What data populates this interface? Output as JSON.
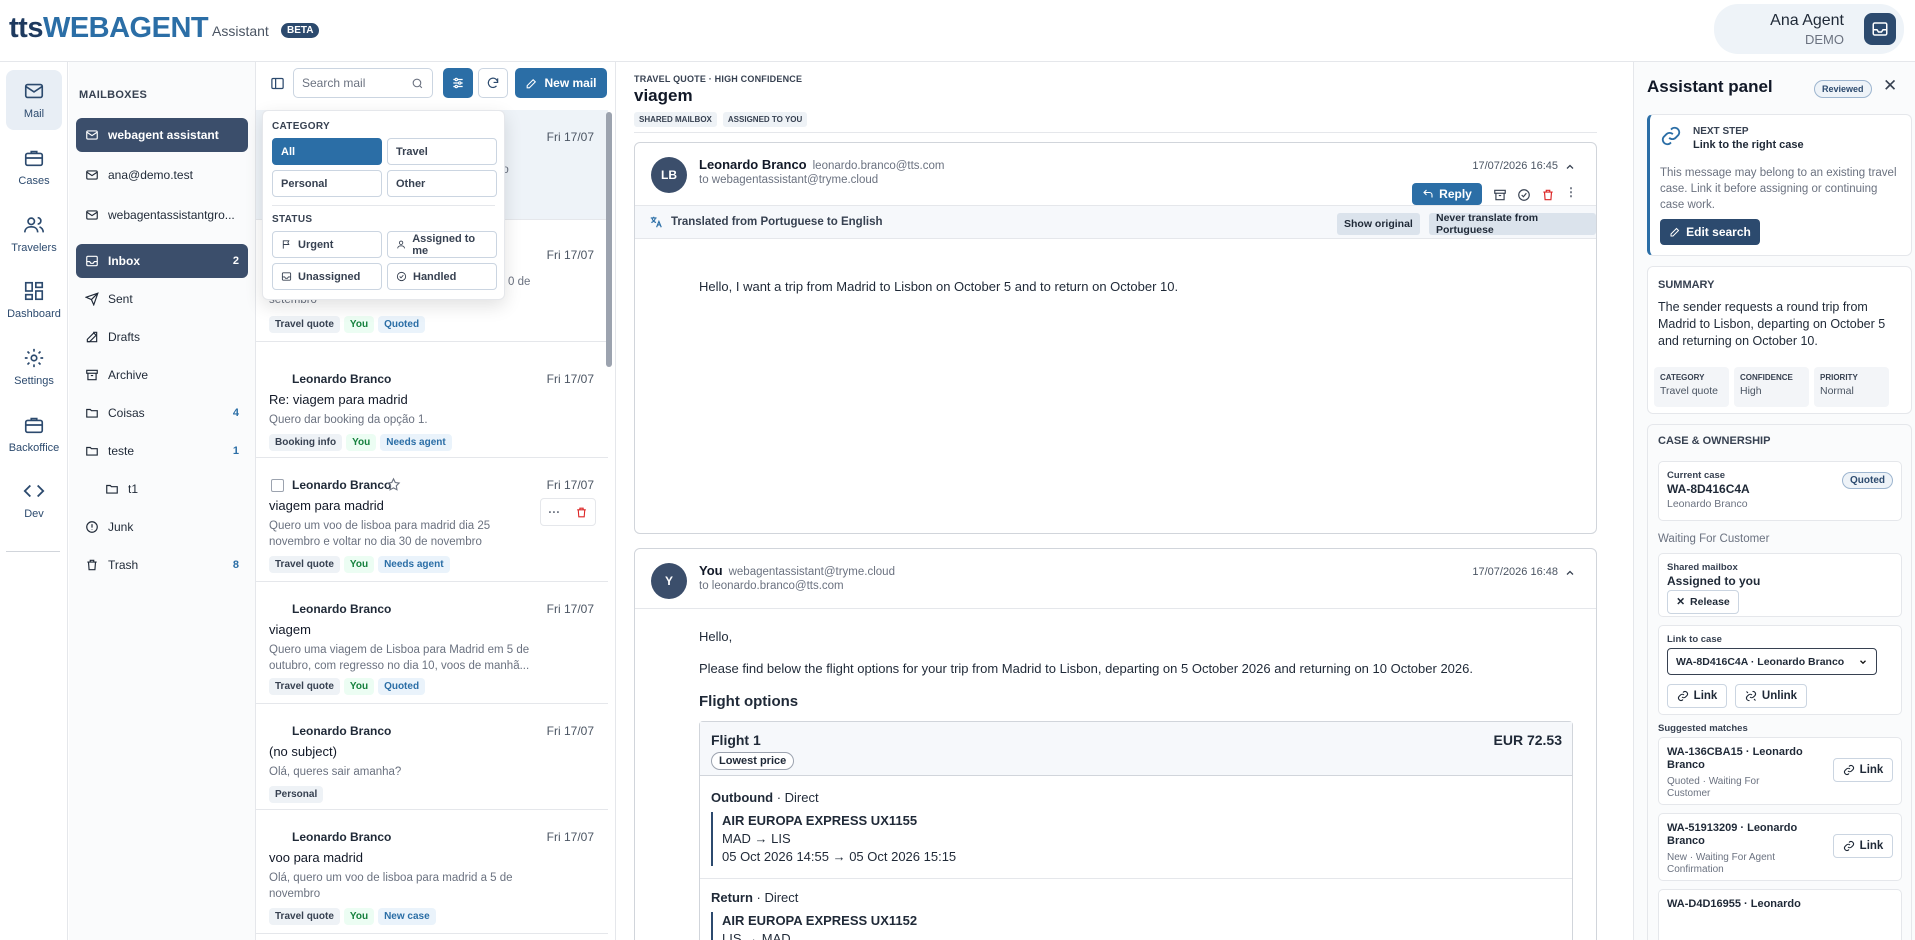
{
  "app": {
    "brand_a": "tts",
    "brand_b": "WEBAGENT",
    "subtitle": "Assistant",
    "beta": "BETA"
  },
  "user": {
    "name": "Ana Agent",
    "role": "DEMO"
  },
  "rail": [
    {
      "label": "Mail",
      "icon": "mail-icon"
    },
    {
      "label": "Cases",
      "icon": "briefcase-icon"
    },
    {
      "label": "Travelers",
      "icon": "users-icon"
    },
    {
      "label": "Dashboard",
      "icon": "dashboard-icon"
    },
    {
      "label": "Settings",
      "icon": "gear-icon"
    },
    {
      "label": "Backoffice",
      "icon": "briefcase-icon"
    },
    {
      "label": "Dev",
      "icon": "code-icon"
    }
  ],
  "mailboxes": {
    "heading": "MAILBOXES",
    "accounts": [
      "webagent assistant",
      "ana@demo.test",
      "webagentassistantgro..."
    ],
    "folders": [
      {
        "label": "Inbox",
        "count": "2"
      },
      {
        "label": "Sent",
        "count": ""
      },
      {
        "label": "Drafts",
        "count": ""
      },
      {
        "label": "Archive",
        "count": ""
      },
      {
        "label": "Coisas",
        "count": "4"
      },
      {
        "label": "teste",
        "count": "1"
      },
      {
        "label": "t1",
        "count": ""
      },
      {
        "label": "Junk",
        "count": ""
      },
      {
        "label": "Trash",
        "count": "8"
      }
    ]
  },
  "list": {
    "search_placeholder": "Search mail",
    "new_mail": "New mail",
    "partial_rows": [
      {
        "date": "Fri 17/07",
        "preview_frag": "no"
      },
      {
        "date": "Fri 17/07",
        "preview_frag": "0 de",
        "preview_tail": "setembro",
        "tags": [
          "Travel quote",
          "You",
          "Quoted"
        ]
      }
    ],
    "rows": [
      {
        "sender": "Leonardo Branco",
        "date": "Fri 17/07",
        "subject": "Re: viagem para madrid",
        "preview": "Quero dar booking da opção 1.",
        "tags": [
          "Booking info",
          "You",
          "Needs agent"
        ]
      },
      {
        "sender": "Leonardo Branco",
        "date": "Fri 17/07",
        "subject": "viagem para madrid",
        "preview": "Quero um voo de lisboa para madrid dia 25 novembro e voltar no dia 30 de novembro",
        "tags": [
          "Travel quote",
          "You",
          "Needs agent"
        ]
      },
      {
        "sender": "Leonardo Branco",
        "date": "Fri 17/07",
        "subject": "viagem",
        "preview": "Quero uma viagem de Lisboa para Madrid em 5 de outubro, com regresso no dia 10, voos de manhã...",
        "tags": [
          "Travel quote",
          "You",
          "Quoted"
        ]
      },
      {
        "sender": "Leonardo Branco",
        "date": "Fri 17/07",
        "subject": "(no subject)",
        "preview": "Olá, queres sair amanha?",
        "tags": [
          "Personal"
        ]
      },
      {
        "sender": "Leonardo Branco",
        "date": "Fri 17/07",
        "subject": "voo para madrid",
        "preview": "Olá, quero um voo de lisboa para madrid a 5 de novembro",
        "tags": [
          "Travel quote",
          "You",
          "New case"
        ]
      }
    ]
  },
  "filter": {
    "category_heading": "CATEGORY",
    "categories": [
      "All",
      "Travel",
      "Personal",
      "Other"
    ],
    "status_heading": "STATUS",
    "statuses": [
      "Urgent",
      "Assigned to me",
      "Unassigned",
      "Handled"
    ]
  },
  "reader": {
    "kicker": "TRAVEL QUOTE · HIGH CONFIDENCE",
    "title": "viagem",
    "badges": [
      "SHARED MAILBOX",
      "ASSIGNED TO YOU"
    ],
    "msg1": {
      "avatar": "LB",
      "from": "Leonardo Branco",
      "email": "leonardo.branco@tts.com",
      "to": "to webagentassistant@tryme.cloud",
      "date": "17/07/2026 16:45",
      "reply": "Reply",
      "translated": "Translated from Portuguese to English",
      "show_original": "Show original",
      "never_translate": "Never translate from Portuguese",
      "body": "Hello, I want a trip from Madrid to Lisbon on October 5 and to return on October 10."
    },
    "msg2": {
      "avatar": "Y",
      "from": "You",
      "email": "webagentassistant@tryme.cloud",
      "to": "to leonardo.branco@tts.com",
      "date": "17/07/2026 16:48",
      "greeting": "Hello,",
      "intro": "Please find below the flight options for your trip from Madrid to Lisbon, departing on 5 October 2026 and returning on 10 October 2026.",
      "options_heading": "Flight options",
      "flight": {
        "name": "Flight 1",
        "price": "EUR 72.53",
        "badge": "Lowest price",
        "outbound_label": "Outbound",
        "outbound_type": "Direct",
        "outbound_carrier": "AIR EUROPA EXPRESS UX1155",
        "outbound_route": "MAD → LIS",
        "outbound_time": "05 Oct 2026 14:55 → 05 Oct 2026 15:15",
        "return_label": "Return",
        "return_type": "Direct",
        "return_carrier": "AIR EUROPA EXPRESS UX1152",
        "return_route": "LIS → MAD"
      }
    }
  },
  "panel": {
    "title": "Assistant panel",
    "reviewed": "Reviewed",
    "next_step_label": "NEXT STEP",
    "next_step_title": "Link to the right case",
    "next_step_text": "This message may belong to an existing travel case. Link it before assigning or continuing case work.",
    "edit_search": "Edit search",
    "summary_heading": "SUMMARY",
    "summary_text": "The sender requests a round trip from Madrid to Lisbon, departing on October 5 and returning on October 10.",
    "meta": [
      {
        "label": "CATEGORY",
        "value": "Travel quote"
      },
      {
        "label": "CONFIDENCE",
        "value": "High"
      },
      {
        "label": "PRIORITY",
        "value": "Normal"
      }
    ],
    "case_heading": "CASE & OWNERSHIP",
    "current_case_label": "Current case",
    "current_case_id": "WA-8D416C4A",
    "current_case_owner": "Leonardo Branco",
    "current_case_status": "Quoted",
    "waiting": "Waiting For Customer",
    "shared_label": "Shared mailbox",
    "shared_value": "Assigned to you",
    "release": "Release",
    "link_to_case_label": "Link to case",
    "link_select": "WA-8D416C4A · Leonardo Branco",
    "link": "Link",
    "unlink": "Unlink",
    "suggested_heading": "Suggested matches",
    "suggestions": [
      {
        "title": "WA-136CBA15 · Leonardo Branco",
        "sub": "Quoted · Waiting For Customer"
      },
      {
        "title": "WA-51913209 · Leonardo Branco",
        "sub": "New · Waiting For Agent Confirmation"
      },
      {
        "title": "WA-D4D16955 · Leonardo",
        "sub": ""
      }
    ]
  }
}
